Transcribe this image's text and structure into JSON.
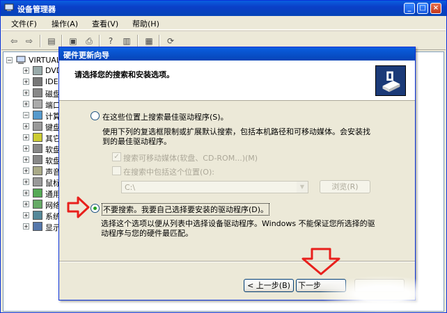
{
  "window": {
    "title": "设备管理器"
  },
  "menubar": {
    "items": [
      "文件(F)",
      "操作(A)",
      "查看(V)",
      "帮助(H)"
    ]
  },
  "toolbar": {
    "icons": [
      "back-icon",
      "forward-icon",
      "show-hide-tree-icon",
      "print-icon",
      "help-icon",
      "properties-icon",
      "computer-icon",
      "scan-hardware-icon"
    ]
  },
  "tree": {
    "root": "VIRTUAL",
    "items": [
      "DVD",
      "IDE",
      "磁盘",
      "端口",
      "计算",
      "键盘",
      "其它",
      "软盘",
      "软盘",
      "声音",
      "鼠标",
      "通用",
      "网络",
      "系统",
      "显示"
    ]
  },
  "wizard": {
    "title": "硬件更新向导",
    "heading": "请选择您的搜索和安装选项。",
    "option1": {
      "label": "在这些位置上搜索最佳驱动程序(S)。",
      "desc_line1": "使用下列的复选框限制或扩展默认搜索，包括本机路径和可移动媒体。会安装找",
      "desc_line2": "到的最佳驱动程序。",
      "check1": "搜索可移动媒体(软盘、CD-ROM...)(M)",
      "check2": "在搜索中包括这个位置(O):",
      "path_value": "C:\\",
      "browse_label": "浏览(R)"
    },
    "option2": {
      "label": "不要搜索。我要自己选择要安装的驱动程序(D)。",
      "desc_line1": "选择这个选项以便从列表中选择设备驱动程序。Windows 不能保证您所选择的驱",
      "desc_line2": "动程序与您的硬件最匹配。"
    },
    "buttons": {
      "back": "< 上一步(B)",
      "next": "下一步"
    }
  },
  "colors": {
    "titlebar": "#0a4fd0",
    "annotation_arrow": "#e8201c",
    "selected_radio": "#21a121"
  }
}
